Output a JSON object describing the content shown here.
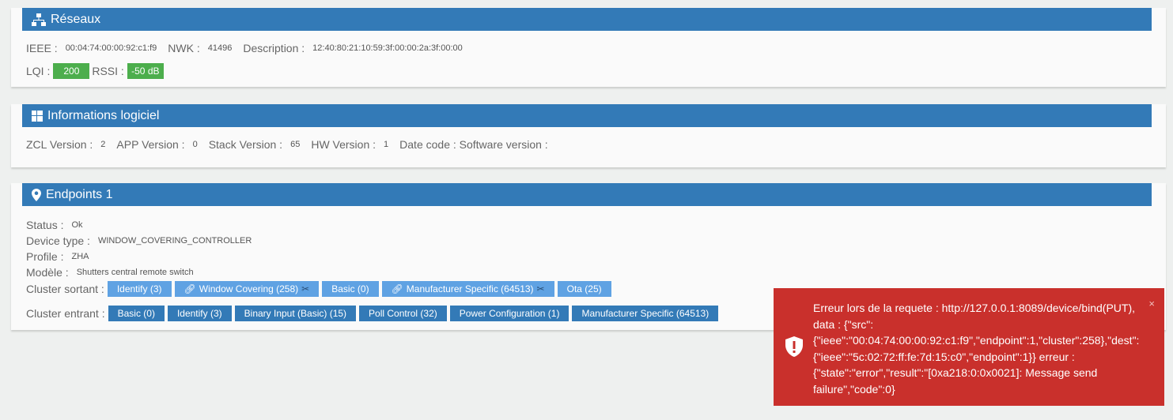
{
  "reseaux": {
    "title": "Réseaux",
    "ieee_label": "IEEE :",
    "ieee": "00:04:74:00:00:92:c1:f9",
    "nwk_label": "NWK :",
    "nwk": "41496",
    "desc_label": "Description :",
    "desc": "12:40:80:21:10:59:3f:00:00:2a:3f:00:00",
    "lqi_label": "LQI :",
    "lqi": "200",
    "rssi_label": "RSSI :",
    "rssi": "-50 dB"
  },
  "logiciel": {
    "title": "Informations logiciel",
    "zcl_label": "ZCL Version :",
    "zcl": "2",
    "app_label": "APP Version :",
    "app": "0",
    "stack_label": "Stack Version :",
    "stack": "65",
    "hw_label": "HW Version :",
    "hw": "1",
    "date_label": "Date code : Software version :"
  },
  "endpoint": {
    "title": "Endpoints 1",
    "status_label": "Status :",
    "status": "Ok",
    "type_label": "Device type :",
    "type": "WINDOW_COVERING_CONTROLLER",
    "profile_label": "Profile :",
    "profile": "ZHA",
    "model_label": "Modèle :",
    "model": "Shutters central remote switch",
    "out_label": "Cluster sortant :",
    "out": [
      "Identify (3)",
      "Window Covering (258)",
      "Basic (0)",
      "Manufacturer Specific (64513)",
      "Ota (25)"
    ],
    "in_label": "Cluster entrant :",
    "in": [
      "Basic (0)",
      "Identify (3)",
      "Binary Input (Basic) (15)",
      "Poll Control (32)",
      "Power Configuration (1)",
      "Manufacturer Specific (64513)"
    ]
  },
  "toast": {
    "message": "Erreur lors de la requete : http://127.0.0.1:8089/device/bind(PUT), data : {\"src\": {\"ieee\":\"00:04:74:00:00:92:c1:f9\",\"endpoint\":1,\"cluster\":258},\"dest\": {\"ieee\":\"5c:02:72:ff:fe:7d:15:c0\",\"endpoint\":1}} erreur : {\"state\":\"error\",\"result\":\"[0xa218:0:0x0021]: Message send failure\",\"code\":0}",
    "close": "×"
  }
}
